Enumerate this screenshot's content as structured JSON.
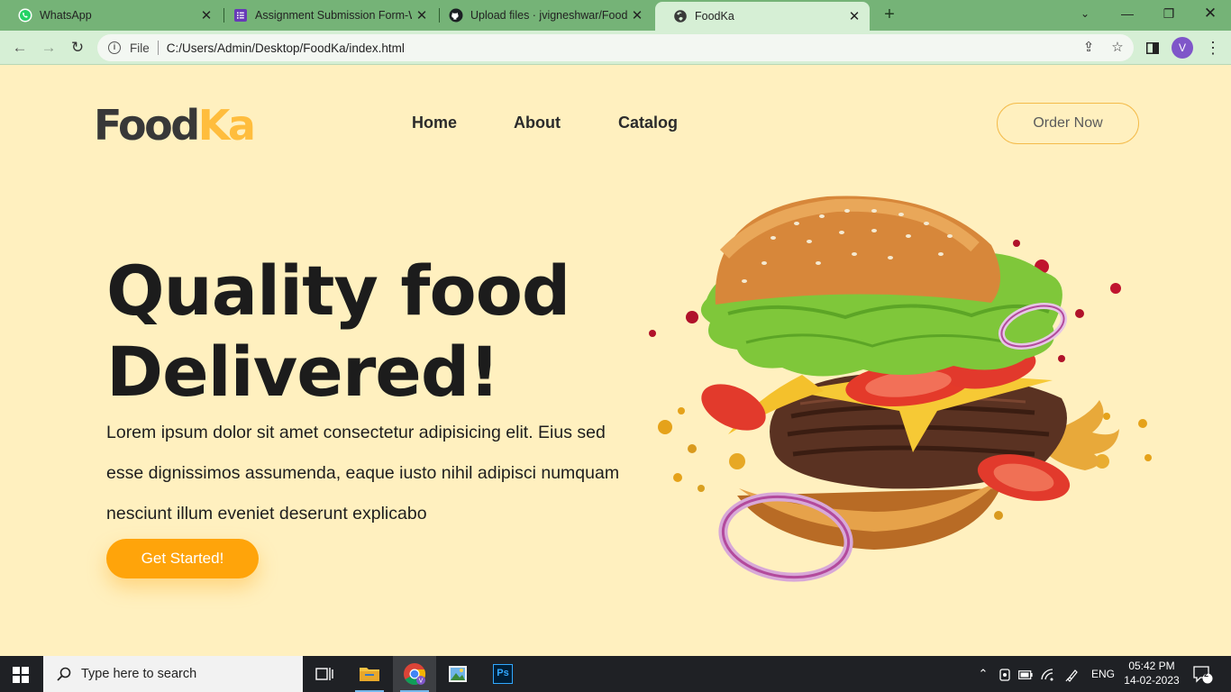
{
  "browser": {
    "tabs": [
      {
        "title": "WhatsApp",
        "icon": "whatsapp-icon",
        "active": false
      },
      {
        "title": "Assignment Submission Form-We",
        "icon": "forms-icon",
        "active": false
      },
      {
        "title": "Upload files · jvigneshwar/FoodKa",
        "icon": "github-icon",
        "active": false
      },
      {
        "title": "FoodKa",
        "icon": "globe-icon",
        "active": true
      }
    ],
    "address": {
      "file_label": "File",
      "url": "C:/Users/Admin/Desktop/FoodKa/index.html"
    },
    "profile_initial": "V",
    "colors": {
      "frame": "#75b377",
      "toolbar": "#d6efd5"
    }
  },
  "site": {
    "logo": {
      "part1": "Food",
      "part2": "Ka"
    },
    "nav": {
      "home": "Home",
      "about": "About",
      "catalog": "Catalog"
    },
    "order_button": "Order Now",
    "hero": {
      "title_line1": "Quality food",
      "title_line2": "Delivered!",
      "description": "Lorem ipsum dolor sit amet consectetur adipisicing elit. Eius sed esse dignissimos assumenda, eaque iusto nihil adipisci numquam nesciunt illum eveniet deserunt explicabo",
      "cta": "Get Started!"
    },
    "colors": {
      "background": "#fff0bf",
      "accent": "#ffa40a",
      "logo_accent": "#ffbd3d",
      "text": "#1c1c1c"
    }
  },
  "taskbar": {
    "search_placeholder": "Type here to search",
    "apps": [
      "task-view-icon",
      "file-explorer-icon",
      "chrome-icon",
      "photos-icon",
      "photoshop-icon"
    ],
    "photoshop_label": "Ps",
    "language": "ENG",
    "time": "05:42 PM",
    "date": "14-02-2023",
    "notification_count": "2"
  }
}
